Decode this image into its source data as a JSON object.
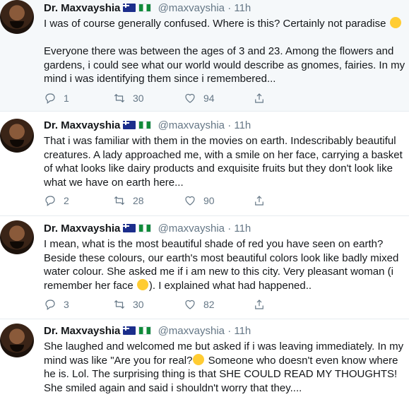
{
  "tweets": [
    {
      "name": "Dr. Maxvayshia",
      "handle": "@maxvayshia",
      "dot": "·",
      "time": "11h",
      "text_a": "I was of course generally confused. Where is this? Certainly not paradise ",
      "text_b": "\n\nEveryone there was between the ages of 3 and 23. Among the flowers and gardens, i could see what our world would describe as gnomes, fairies. In my mind i was identifying them since i remembered...",
      "replies": "1",
      "retweets": "30",
      "likes": "94"
    },
    {
      "name": "Dr. Maxvayshia",
      "handle": "@maxvayshia",
      "dot": "·",
      "time": "11h",
      "text_a": "That i was familiar with them in the movies on earth. Indescribably beautiful creatures. A lady approached me, with a smile on her face, carrying a basket of what looks like dairy products and exquisite fruits but they don't look like what we have on earth here...",
      "text_b": "",
      "replies": "2",
      "retweets": "28",
      "likes": "90"
    },
    {
      "name": "Dr. Maxvayshia",
      "handle": "@maxvayshia",
      "dot": "·",
      "time": "11h",
      "text_a": "I mean, what is the most beautiful shade of red you have seen on earth? Beside these colours, our earth's most beautiful colors look like badly mixed water colour. She asked me if i am new to this city. Very pleasant woman (i remember her face ",
      "text_b": "). I explained what had happened..",
      "replies": "3",
      "retweets": "30",
      "likes": "82"
    },
    {
      "name": "Dr. Maxvayshia",
      "handle": "@maxvayshia",
      "dot": "·",
      "time": "11h",
      "text_a": "She laughed and welcomed me but asked if i was leaving immediately. In my mind was like \"Are you for real?",
      "text_b": " Someone who doesn't even know where he is. Lol. The surprising thing is that SHE COULD READ MY THOUGHTS! She smiled again and said i shouldn't worry that they....",
      "replies": "",
      "retweets": "",
      "likes": ""
    }
  ],
  "icons": {
    "avatar": "profile-photo",
    "flag_1": "australia-flag",
    "flag_2": "nigeria-flag",
    "reply": "reply-icon",
    "retweet": "retweet-icon",
    "like": "heart-icon",
    "share": "share-icon",
    "emoji_1": "tears-of-joy-emoji",
    "emoji_3": "smiling-face-emoji",
    "emoji_4": "unamused-face-emoji"
  },
  "colors": {
    "text": "#14171a",
    "muted": "#657786",
    "highlight_bg": "#f5f8fa",
    "border": "#e6ecf0"
  }
}
